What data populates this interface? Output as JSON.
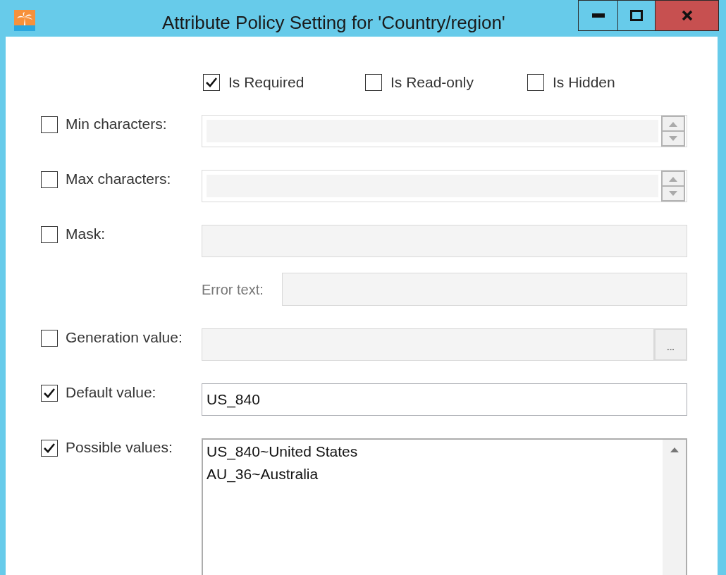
{
  "window": {
    "title": "Attribute Policy Setting for 'Country/region'"
  },
  "options": [
    {
      "label": "Is Required",
      "checked": true
    },
    {
      "label": "Is Read-only",
      "checked": false
    },
    {
      "label": "Is Hidden",
      "checked": false
    }
  ],
  "fields": [
    {
      "kind": "spin",
      "label": "Min characters:",
      "checked": false
    },
    {
      "kind": "spin",
      "label": "Max characters:",
      "checked": false
    },
    {
      "kind": "mask",
      "label": "Mask:",
      "checked": false,
      "error_label": "Error text:"
    },
    {
      "kind": "browse",
      "label": "Generation value:",
      "checked": false,
      "button_label": "..."
    },
    {
      "kind": "text",
      "label": "Default value:",
      "checked": true,
      "value": "US_840"
    },
    {
      "kind": "list",
      "label": "Possible values:",
      "checked": true,
      "lines": [
        "US_840~United States",
        "AU_36~Australia"
      ]
    }
  ]
}
